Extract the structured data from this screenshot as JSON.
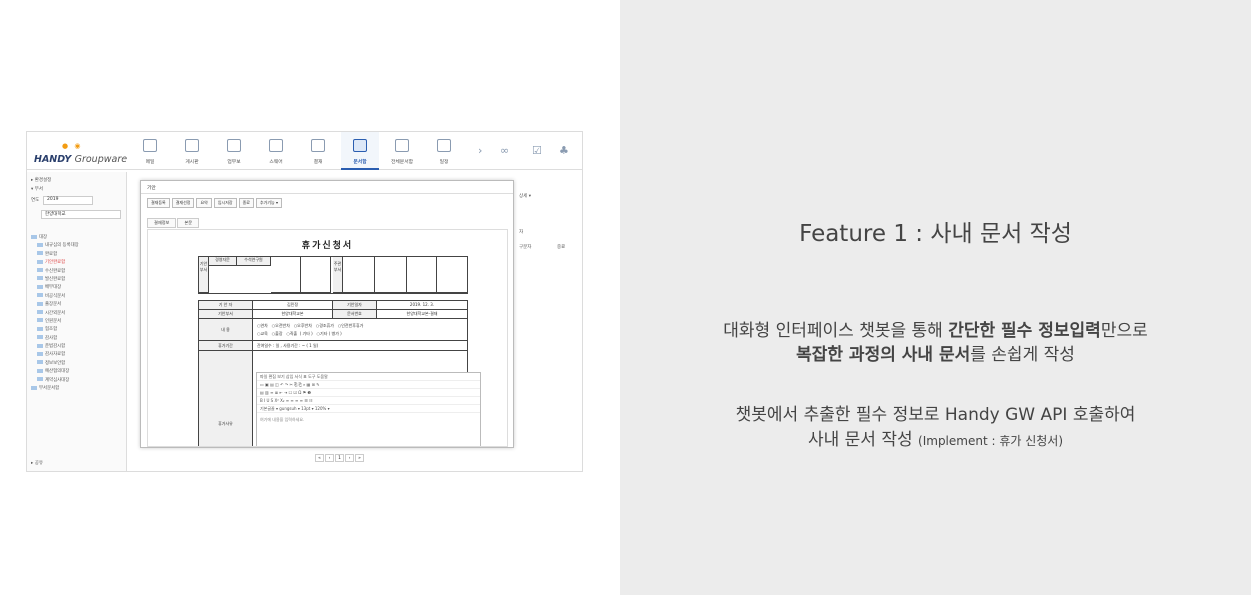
{
  "app": {
    "logo_main": "HANDY",
    "logo_sub": "Groupware",
    "nav": [
      {
        "label": "메일",
        "icon": "mail-icon"
      },
      {
        "label": "게시판",
        "icon": "board-icon"
      },
      {
        "label": "업무보",
        "icon": "work-icon"
      },
      {
        "label": "스웨어",
        "icon": "share-icon"
      },
      {
        "label": "결재",
        "icon": "approval-icon"
      },
      {
        "label": "문서함",
        "icon": "document-box-icon"
      },
      {
        "label": "전체문서함",
        "icon": "all-documents-icon"
      },
      {
        "label": "일정",
        "icon": "calendar-icon"
      }
    ],
    "sidebar": {
      "top1": "▸ 환경설정",
      "top2": "▾ 부서",
      "year_label": "연도",
      "year_value": "2019",
      "dept_value": "한양대학교",
      "tree_root": "대장",
      "tree": [
        "내규심의 등록대장",
        "완료함",
        "기안완료함",
        "수신완료함",
        "발신완료함",
        "배부대장",
        "비공식문서",
        "출장문서",
        "시간외문서",
        "인원문서",
        "협조함",
        "감사함",
        "준법감시함",
        "감사자료함",
        "정보보안함",
        "예산협의대장",
        "계약심사대장"
      ],
      "tree_last": "부서문서함",
      "bottom": "▸ 공유"
    },
    "modal": {
      "title": "기안",
      "toolbar": [
        "결재등록",
        "결재선정",
        "요약",
        "임시저장",
        "종료",
        "추가기능 ▾"
      ],
      "tabs": [
        "결재정보",
        "본문"
      ],
      "doc_title": "휴가신청서",
      "approval_label": "기안부서",
      "approval_cols": [
        "경영자문",
        "수석연구원"
      ],
      "coop_label": "주관부서",
      "row_drafter_label": "기 안 자",
      "row_drafter_value": "김민정",
      "row_date_label": "기안일자",
      "row_date_value": "2019. 12. 3.",
      "row_dept_label": "기안부서",
      "row_dept_value": "한양대학교본",
      "row_docno_label": "문서번호",
      "row_docno_value": "한양대학교본-결재",
      "content_label": "내 용",
      "options1": "○연차   ○오전반차   ○오후반차   ○경조휴가   ○인전반후휴가",
      "options2": "○교육   ○출장   ○직출  ( 기타 )   ○기타 ( 병가 )",
      "period_label": "휴가기간",
      "period_value": "잔여일수 : 일 , 사용기간 :   ~   ( 1   일)",
      "reason_label": "휴가사유",
      "editor_menu": "파일   편집   보기   삽입   서식   표   도구   도움말",
      "editor_font": "기본글꼴 ▾   gungsuh ▾   13pt ▾   120% ▾",
      "editor_placeholder": "여기에 내용을 입력하세요."
    },
    "right_labels": [
      "상세 ▾",
      "자",
      "구분자",
      "중료"
    ]
  },
  "feature": {
    "title": "Feature 1 : 사내 문서 작성",
    "p1_a": "대화형 인터페이스 챗봇을 통해 ",
    "p1_b": "간단한 필수 정보입력",
    "p1_c": "만으로",
    "p2_a": "복잡한 과정의 사내 문서",
    "p2_b": "를 손쉽게 작성",
    "p3": "챗봇에서 추출한 필수 정보로 Handy GW API 호출하여",
    "p4_a": "사내 문서 작성 ",
    "p4_b": "(Implement : 휴가 신청서)"
  }
}
